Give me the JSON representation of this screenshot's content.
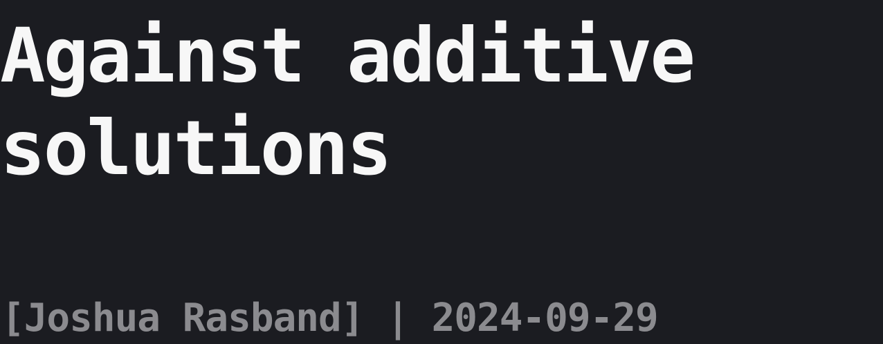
{
  "post": {
    "title_line1": "Against additive",
    "title_line2": "solutions",
    "byline": "[Joshua Rasband] | 2024-09-29"
  },
  "colors": {
    "background": "#1b1c21",
    "title": "#f7f7f7",
    "byline": "#8b8b8f"
  }
}
